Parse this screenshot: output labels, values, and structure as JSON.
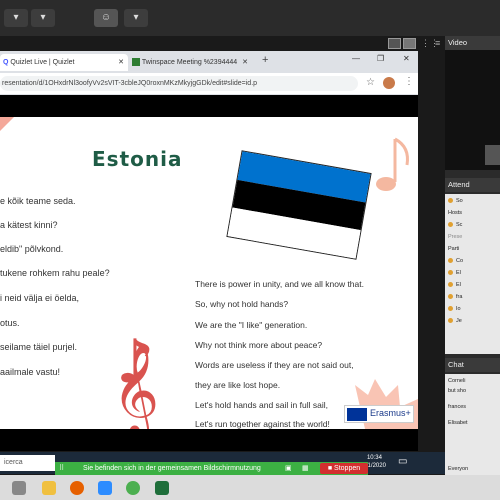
{
  "conference": {
    "video_label": "Video",
    "attendees_label": "Attend",
    "chat_label": "Chat",
    "stop_label": "Stoppen",
    "share_notice": "Sie befinden sich in der gemeinsamen Bildschirmnutzung",
    "attendee_rows": [
      "So",
      "Hosts",
      "Sc",
      "Prese",
      "Parti",
      "Co",
      "El",
      "El",
      "fra",
      "Io",
      "Je"
    ],
    "chat_lines": [
      "Corneli",
      "but sho",
      "frances",
      "Elisabet",
      "Everyon"
    ]
  },
  "browser": {
    "tab1_title": "Quizlet Live | Quizlet",
    "tab2_title": "Twinspace Meeting %2394444",
    "url": "resentation/d/1OHxdrNl3oofyVv2sVIT-3cbleJQ0roxnMKzMkyjgGDk/edit#slide=id.p"
  },
  "slide": {
    "title": "Estonia",
    "left_lines": [
      "e kõik teame seda.",
      "a kätest kinni?",
      "eldib\" põlvkond.",
      "tukene rohkem rahu peale?",
      "i neid välja ei öelda,",
      "otus.",
      "seilame täiel purjel.",
      "aailmale vastu!"
    ],
    "right_lines": [
      "There is power in unity, and we all know that.",
      "So, why not hold hands?",
      "We are the \"I like\" generation.",
      "Why not think more about peace?",
      "Words are useless if they are not said out,",
      "they are like lost hope.",
      "Let's hold hands and sail in full sail,",
      "Let's run together against the world!"
    ],
    "logo_text": "Erasmus+"
  },
  "taskbar": {
    "search_placeholder": "icerca",
    "time": "10:34",
    "date": "/11/2020"
  },
  "colors": {
    "flag_blue": "#0072ce",
    "flag_black": "#000000",
    "flag_white": "#ffffff",
    "title_green": "#1f5c46",
    "share_green": "#3cb043",
    "stop_red": "#d32f2f"
  }
}
